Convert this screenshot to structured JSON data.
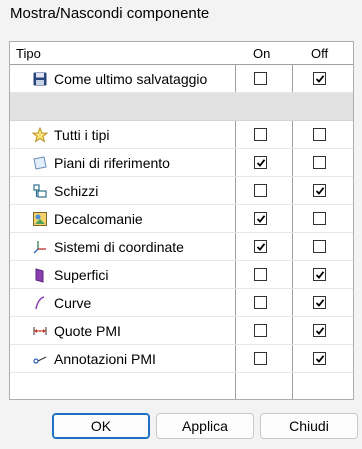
{
  "dialog": {
    "title": "Mostra/Nascondi componente"
  },
  "table": {
    "headers": {
      "type": "Tipo",
      "on": "On",
      "off": "Off"
    },
    "rows": [
      {
        "label": "Come ultimo salvataggio",
        "icon": "save-icon",
        "on": false,
        "off": true
      },
      {
        "label": "",
        "separator": true
      },
      {
        "label": "Tutti i tipi",
        "icon": "star-icon",
        "on": false,
        "off": false
      },
      {
        "label": "Piani di riferimento",
        "icon": "plane-icon",
        "on": true,
        "off": false
      },
      {
        "label": "Schizzi",
        "icon": "sketch-icon",
        "on": false,
        "off": true
      },
      {
        "label": "Decalcomanie",
        "icon": "decal-icon",
        "on": true,
        "off": false
      },
      {
        "label": "Sistemi di coordinate",
        "icon": "coordinate-system-icon",
        "on": true,
        "off": false
      },
      {
        "label": "Superfici",
        "icon": "surface-icon",
        "on": false,
        "off": true
      },
      {
        "label": "Curve",
        "icon": "curve-icon",
        "on": false,
        "off": true
      },
      {
        "label": "Quote PMI",
        "icon": "pmi-dimension-icon",
        "on": false,
        "off": true
      },
      {
        "label": "Annotazioni PMI",
        "icon": "pmi-annotation-icon",
        "on": false,
        "off": true
      }
    ]
  },
  "buttons": {
    "ok": "OK",
    "apply": "Applica",
    "close": "Chiudi"
  },
  "colors": {
    "accent": "#1e6fc4",
    "grid_line": "#a0a0a0",
    "separator_row": "#e1e1e1"
  }
}
